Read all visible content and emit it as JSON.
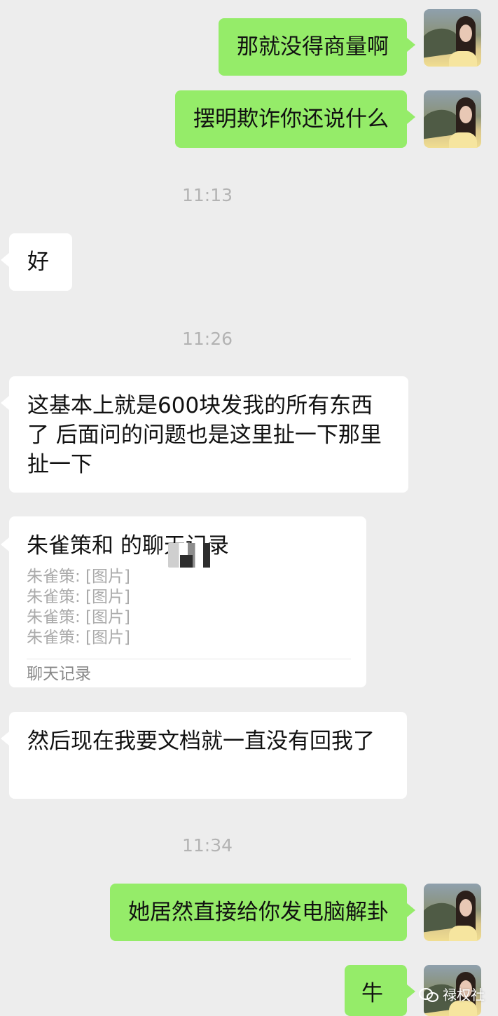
{
  "messages": [
    {
      "sender": "me",
      "text": "那就没得商量啊"
    },
    {
      "sender": "me",
      "text": "摆明欺诈你还说什么"
    },
    {
      "type": "time",
      "text": "11:13"
    },
    {
      "sender": "other",
      "text": "好"
    },
    {
      "type": "time",
      "text": "11:26"
    },
    {
      "sender": "other",
      "text": "这基本上就是600块发我的所有东西了 后面问的问题也是这里扯一下那里扯一下"
    },
    {
      "sender": "other",
      "type": "chat_record",
      "title": "朱雀策和      的聊天记录",
      "lines": [
        "朱雀策: [图片]",
        "朱雀策: [图片]",
        "朱雀策: [图片]",
        "朱雀策: [图片]"
      ],
      "footer": "聊天记录"
    },
    {
      "sender": "other",
      "text": "然后现在我要文档就一直没有回我了"
    },
    {
      "type": "time",
      "text": "11:34"
    },
    {
      "sender": "me",
      "text": "她居然直接给你发电脑解卦"
    },
    {
      "sender": "me",
      "text": "牛"
    }
  ],
  "watermark": {
    "text": "禄权社"
  },
  "colors": {
    "background": "#ededed",
    "outgoing_bubble": "#95ec69",
    "incoming_bubble": "#ffffff",
    "timestamp": "#b3b3b3"
  },
  "icons": {
    "avatar": "profile-photo-icon",
    "watermark": "wechat-icon"
  }
}
